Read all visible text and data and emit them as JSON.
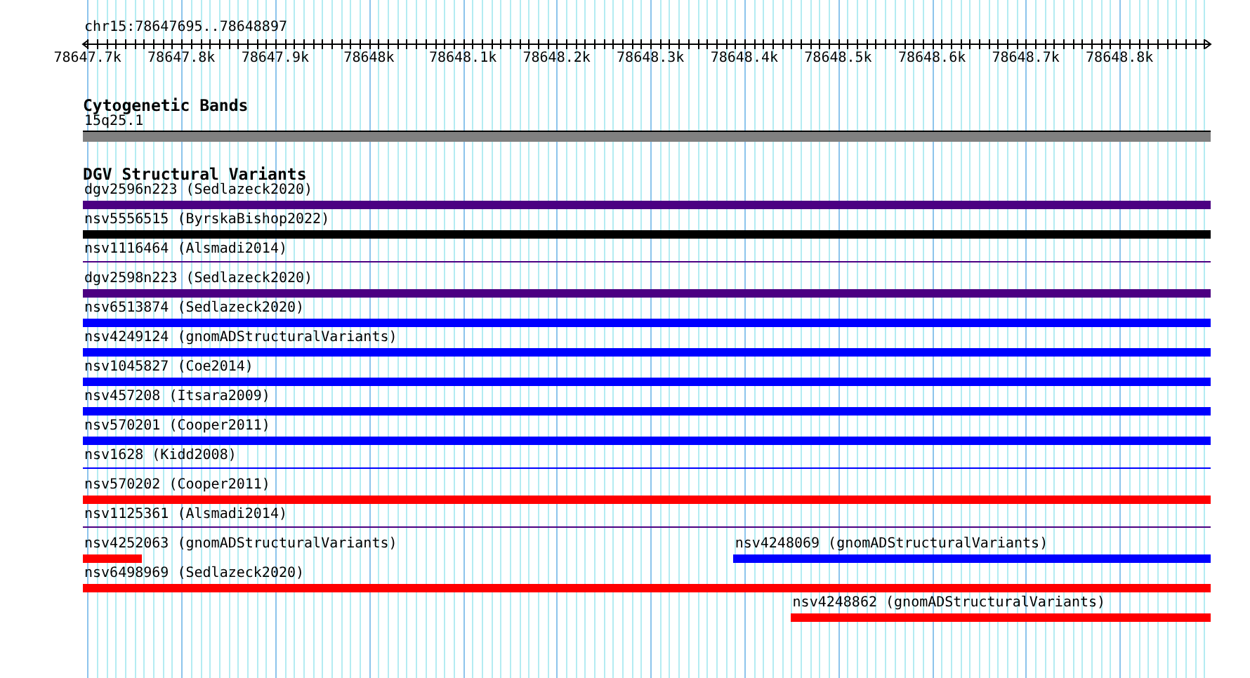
{
  "view": {
    "locus": "chr15:78647695..78648897"
  },
  "ruler": {
    "ticks": [
      "78647.7k",
      "78647.8k",
      "78647.9k",
      "78648k",
      "78648.1k",
      "78648.2k",
      "78648.3k",
      "78648.4k",
      "78648.5k",
      "78648.6k",
      "78648.7k",
      "78648.8k"
    ]
  },
  "tracks": [
    {
      "title": "Cytogenetic Bands",
      "kind": "bands",
      "rows": [
        {
          "features": [
            {
              "label": "15q25.1",
              "kind": "band",
              "color": "#808080"
            }
          ]
        }
      ]
    },
    {
      "title": "DGV Structural Variants",
      "kind": "variants",
      "rows": [
        {
          "features": [
            {
              "label": "dgv2596n223 (Sedlazeck2020)",
              "kind": "thick",
              "color": "#4b0082"
            }
          ]
        },
        {
          "features": [
            {
              "label": "nsv5556515 (ByrskaBishop2022)",
              "kind": "thick",
              "color": "#000000"
            }
          ]
        },
        {
          "features": [
            {
              "label": "nsv1116464 (Alsmadi2014)",
              "kind": "thin",
              "color": "#4b0082"
            }
          ]
        },
        {
          "features": [
            {
              "label": "dgv2598n223 (Sedlazeck2020)",
              "kind": "thick",
              "color": "#4b0082"
            }
          ]
        },
        {
          "features": [
            {
              "label": "nsv6513874 (Sedlazeck2020)",
              "kind": "thick",
              "color": "#0000ff"
            }
          ]
        },
        {
          "features": [
            {
              "label": "nsv4249124 (gnomADStructuralVariants)",
              "kind": "thick",
              "color": "#0000ff"
            }
          ]
        },
        {
          "features": [
            {
              "label": "nsv1045827 (Coe2014)",
              "kind": "thick",
              "color": "#0000ff"
            }
          ]
        },
        {
          "features": [
            {
              "label": "nsv457208 (Itsara2009)",
              "kind": "thick",
              "color": "#0000ff"
            }
          ]
        },
        {
          "features": [
            {
              "label": "nsv570201 (Cooper2011)",
              "kind": "thick",
              "color": "#0000ff"
            }
          ]
        },
        {
          "features": [
            {
              "label": "nsv1628 (Kidd2008)",
              "kind": "thin",
              "color": "#0000ff"
            }
          ]
        },
        {
          "features": [
            {
              "label": "nsv570202 (Cooper2011)",
              "kind": "thick",
              "color": "#ff0000"
            }
          ]
        },
        {
          "features": [
            {
              "label": "nsv1125361 (Alsmadi2014)",
              "kind": "thin",
              "color": "#4b0082"
            }
          ]
        },
        {
          "features": [
            {
              "label": "nsv4252063 (gnomADStructuralVariants)",
              "kind": "head",
              "color": "#ff0000"
            },
            {
              "label": "nsv4248069 (gnomADStructuralVariants)",
              "kind": "tail",
              "color": "#0000ff"
            }
          ]
        },
        {
          "features": [
            {
              "label": "nsv6498969 (Sedlazeck2020)",
              "kind": "thick",
              "color": "#ff0000"
            }
          ]
        },
        {
          "features": [
            {
              "label": "nsv4248862 (gnomADStructuralVariants)",
              "kind": "stub",
              "color": "#ff0000"
            }
          ]
        }
      ]
    }
  ]
}
